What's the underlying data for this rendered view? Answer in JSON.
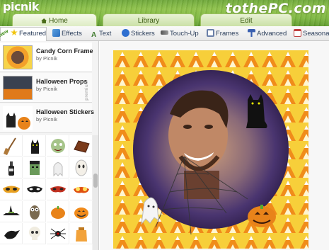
{
  "app": {
    "logo": "picnik",
    "watermark": "tothePC.com"
  },
  "tabs": [
    {
      "label": "Home",
      "active": true
    },
    {
      "label": "Library",
      "active": false
    },
    {
      "label": "Edit",
      "active": false
    }
  ],
  "toolbar": {
    "new_badge": "New",
    "items": [
      {
        "label": "Featured",
        "icon": "star-icon"
      },
      {
        "label": "Effects",
        "icon": "effects-icon"
      },
      {
        "label": "Text",
        "icon": "text-icon"
      },
      {
        "label": "Stickers",
        "icon": "stickers-icon"
      },
      {
        "label": "Touch-Up",
        "icon": "touchup-icon"
      },
      {
        "label": "Frames",
        "icon": "frames-icon"
      },
      {
        "label": "Advanced",
        "icon": "advanced-icon"
      },
      {
        "label": "Seasonal",
        "icon": "seasonal-icon"
      }
    ]
  },
  "packs": [
    {
      "title": "Candy Corn Frame",
      "by": "by Picnik",
      "selected": true
    },
    {
      "title": "Halloween Props",
      "by": "by Picnik",
      "premium_label": "premium"
    },
    {
      "title": "Halloween Stickers",
      "by": "by Picnik"
    }
  ],
  "stickers": [
    "broom-sticker",
    "black-cat-sticker",
    "zombie-face-sticker",
    "coffin-sticker",
    "bottle-sticker",
    "frankenstein-sticker",
    "ghost-sticker",
    "mask-sticker",
    "orange-mask-sticker",
    "black-mask-sticker",
    "devil-mask-sticker",
    "bug-eye-mask-sticker",
    "witch-hat-sticker",
    "owl-sticker",
    "pumpkin-sticker",
    "jack-o-lantern-sticker",
    "crow-sticker",
    "skull-sticker",
    "spider-sticker",
    "candy-bag-sticker"
  ],
  "colors": {
    "accent_green": "#7cb640",
    "candy_orange": "#f39a1f",
    "candy_yellow": "#f7d02b"
  }
}
